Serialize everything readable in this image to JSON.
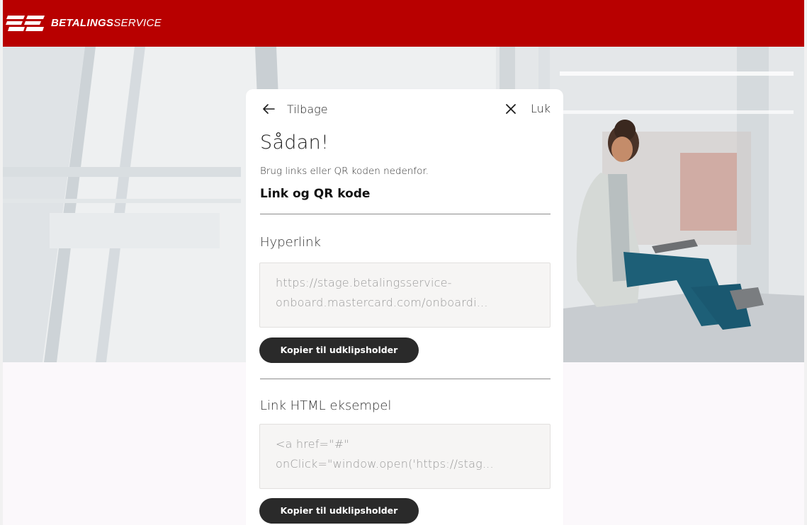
{
  "brand": {
    "name_bold": "BETALINGS",
    "name_light": "SERVICE",
    "logo_icon": "bs-logo-icon",
    "color": "#b80000"
  },
  "nav": {
    "back_label": "Tilbage",
    "back_icon": "arrow-left-icon",
    "close_label": "Luk",
    "close_icon": "close-icon"
  },
  "page": {
    "title": "Sådan!",
    "subtitle": "Brug links eller QR koden nedenfor.",
    "section_title": "Link og QR kode"
  },
  "hyperlink": {
    "label": "Hyperlink",
    "value_line1": "https://stage.betalingsservice-",
    "value_line2": "onboard.mastercard.com/onboardi...",
    "copy_label": "Kopier til udklipsholder"
  },
  "html_example": {
    "label": "Link HTML eksempel",
    "value_line1": "<a href=\"#\"",
    "value_line2": "onClick=\"window.open('https://stag...",
    "copy_label": "Kopier til udklipsholder"
  },
  "colors": {
    "topbar": "#b80000",
    "button": "#2a2a2a",
    "field_bg": "#f6f5f4",
    "page_bg": "#fbf8fb"
  }
}
